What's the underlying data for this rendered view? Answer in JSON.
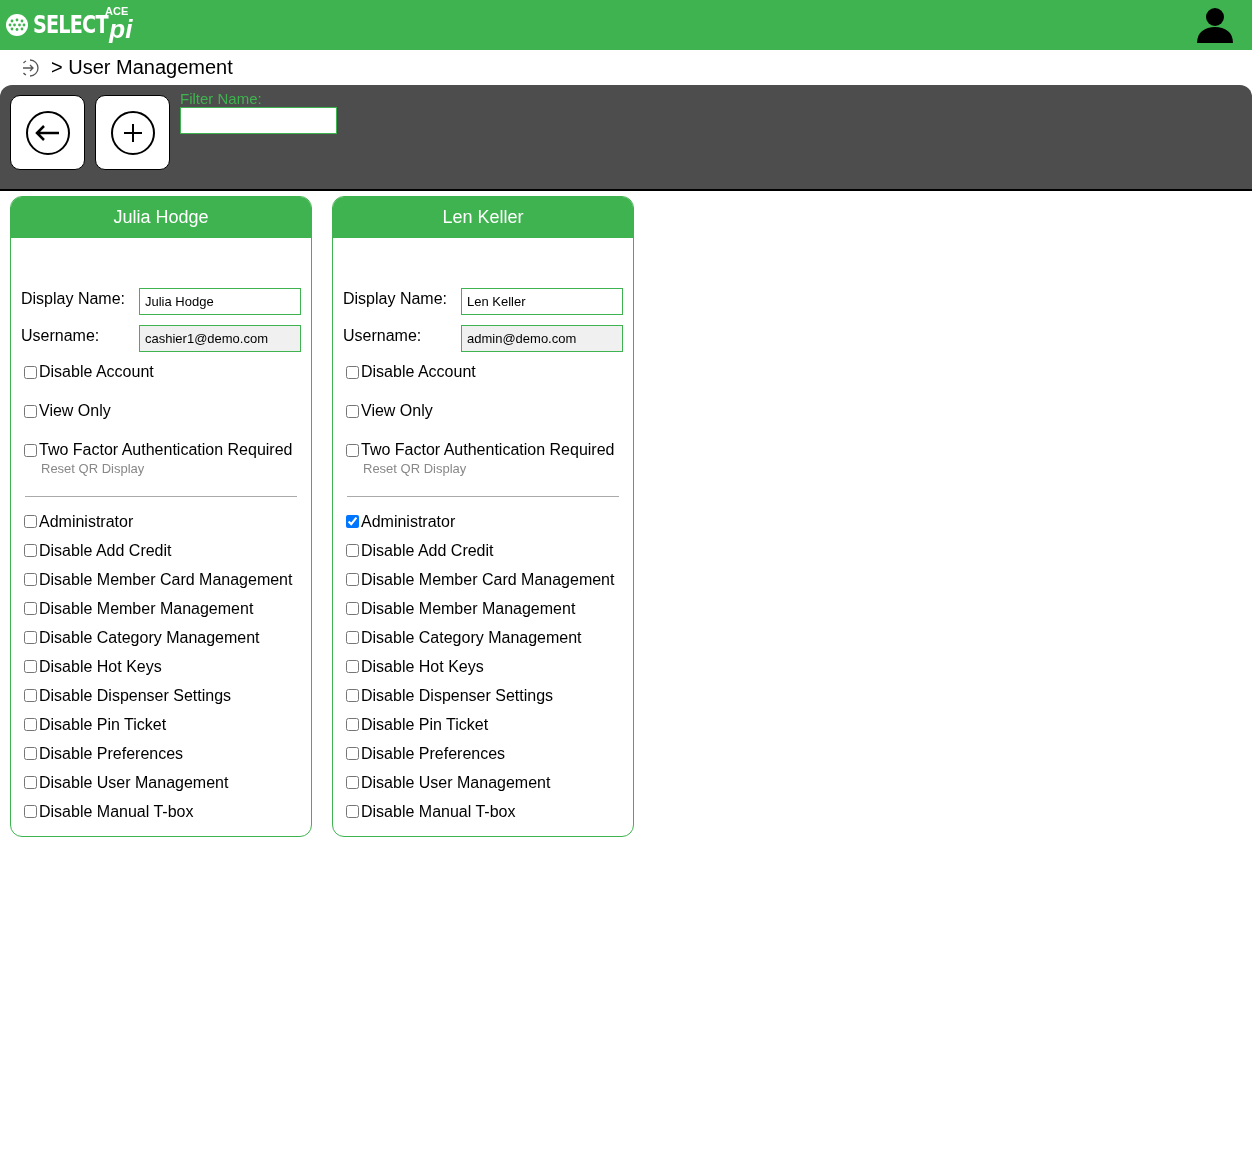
{
  "header": {
    "logo": {
      "brand": "SELECT",
      "suffix": "pi",
      "edition": "ACE"
    }
  },
  "breadcrumb": {
    "text": "> User Management"
  },
  "toolbar": {
    "filter": {
      "label": "Filter Name:"
    }
  },
  "users": [
    {
      "title": "Julia Hodge",
      "fields": [
        {
          "label": "Display Name:",
          "value": "Julia Hodge",
          "disabled": false
        },
        {
          "label": "Username:",
          "value": "cashier1@demo.com",
          "disabled": true
        }
      ],
      "account_options": [
        {
          "label": "Disable Account",
          "checked": false
        },
        {
          "label": "View Only",
          "checked": false
        },
        {
          "label": "Two Factor Authentication Required",
          "checked": false
        }
      ],
      "reset_link": "Reset QR Display",
      "permissions": [
        {
          "label": "Administrator",
          "checked": false
        },
        {
          "label": "Disable Add Credit",
          "checked": false
        },
        {
          "label": "Disable Member Card Management",
          "checked": false
        },
        {
          "label": "Disable Member Management",
          "checked": false
        },
        {
          "label": "Disable Category Management",
          "checked": false
        },
        {
          "label": "Disable Hot Keys",
          "checked": false
        },
        {
          "label": "Disable Dispenser Settings",
          "checked": false
        },
        {
          "label": "Disable Pin Ticket",
          "checked": false
        },
        {
          "label": "Disable Preferences",
          "checked": false
        },
        {
          "label": "Disable User Management",
          "checked": false
        },
        {
          "label": "Disable Manual T-box",
          "checked": false
        }
      ]
    },
    {
      "title": "Len Keller",
      "fields": [
        {
          "label": "Display Name:",
          "value": "Len Keller",
          "disabled": false
        },
        {
          "label": "Username:",
          "value": "admin@demo.com",
          "disabled": true
        }
      ],
      "account_options": [
        {
          "label": "Disable Account",
          "checked": false
        },
        {
          "label": "View Only",
          "checked": false
        },
        {
          "label": "Two Factor Authentication Required",
          "checked": false
        }
      ],
      "reset_link": "Reset QR Display",
      "permissions": [
        {
          "label": "Administrator",
          "checked": true
        },
        {
          "label": "Disable Add Credit",
          "checked": false
        },
        {
          "label": "Disable Member Card Management",
          "checked": false
        },
        {
          "label": "Disable Member Management",
          "checked": false
        },
        {
          "label": "Disable Category Management",
          "checked": false
        },
        {
          "label": "Disable Hot Keys",
          "checked": false
        },
        {
          "label": "Disable Dispenser Settings",
          "checked": false
        },
        {
          "label": "Disable Pin Ticket",
          "checked": false
        },
        {
          "label": "Disable Preferences",
          "checked": false
        },
        {
          "label": "Disable User Management",
          "checked": false
        },
        {
          "label": "Disable Manual T-box",
          "checked": false
        }
      ]
    }
  ]
}
